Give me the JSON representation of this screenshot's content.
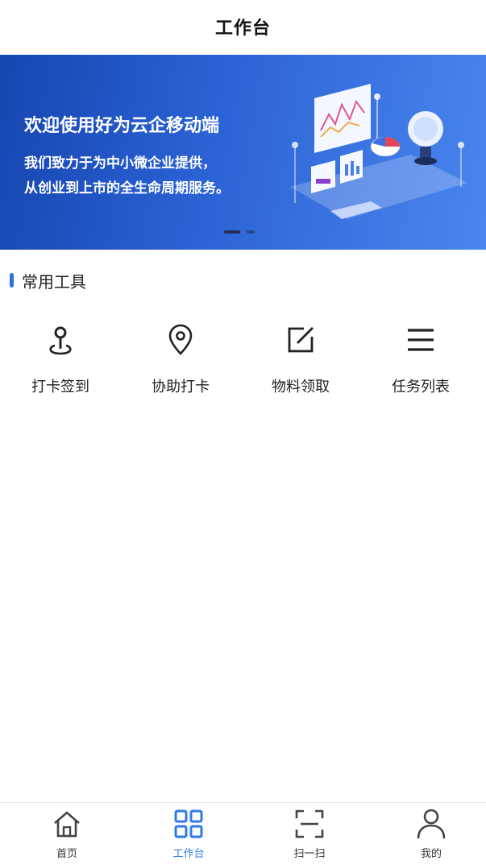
{
  "header": {
    "title": "工作台"
  },
  "banner": {
    "headline": "欢迎使用好为云企移动端",
    "desc_line1": "我们致力于为中小微企业提供，",
    "desc_line2": "从创业到上市的全生命周期服务。",
    "gradient_start": "#1646b0",
    "gradient_end": "#4a86ee"
  },
  "section": {
    "title": "常用工具",
    "accent": "#2f6fe0"
  },
  "tools": [
    {
      "label": "打卡签到",
      "icon": "map-pin-checkin-icon"
    },
    {
      "label": "协助打卡",
      "icon": "location-pin-icon"
    },
    {
      "label": "物料领取",
      "icon": "edit-square-icon"
    },
    {
      "label": "任务列表",
      "icon": "list-menu-icon"
    }
  ],
  "tabbar": {
    "active_color": "#2f7be2",
    "items": [
      {
        "label": "首页",
        "icon": "home-icon"
      },
      {
        "label": "工作台",
        "icon": "grid-icon"
      },
      {
        "label": "扫一扫",
        "icon": "scan-icon"
      },
      {
        "label": "我的",
        "icon": "user-icon"
      }
    ]
  }
}
